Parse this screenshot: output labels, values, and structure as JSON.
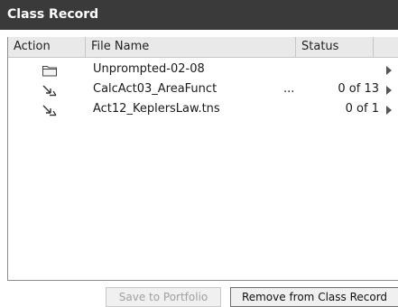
{
  "window": {
    "title": "Class Record"
  },
  "table": {
    "columns": [
      "Action",
      "File Name",
      "Status",
      ""
    ],
    "rows": [
      {
        "icon": "folder-icon",
        "name": "Unprompted-02-08",
        "dots": "",
        "status": ""
      },
      {
        "icon": "send-arrow-icon",
        "name": "CalcAct03_AreaFunct",
        "dots": "...",
        "status": "0 of 13"
      },
      {
        "icon": "send-arrow-icon",
        "name": "Act12_KeplersLaw.tns",
        "dots": "",
        "status": "0 of 1"
      }
    ]
  },
  "buttons": {
    "save_to_portfolio": "Save to Portfolio",
    "remove_from_class_record": "Remove from Class Record"
  },
  "colors": {
    "titlebar": "#3a3a3a",
    "header": "#e9e9e9",
    "disabled_text": "#a0a0a0"
  }
}
